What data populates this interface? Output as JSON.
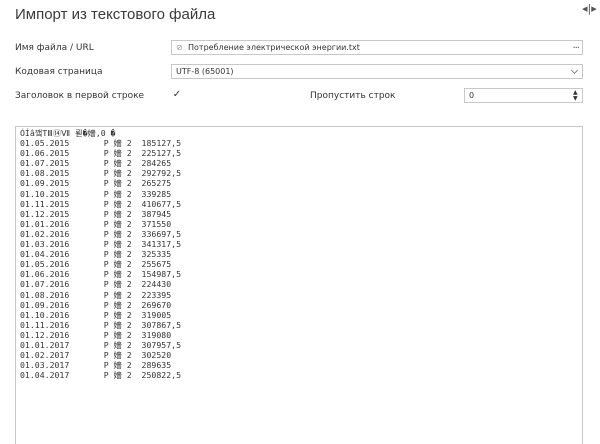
{
  "dialog": {
    "title": "Импорт из текстового файла"
  },
  "form": {
    "file_label": "Имя файла / URL",
    "file_value": "Потребление электрической энергии.txt",
    "browse_label": "...",
    "encoding_label": "Кодовая страница",
    "encoding_value": "UTF-8 (65001)",
    "header_label": "Заголовок в первой строке",
    "header_checked_glyph": "✓",
    "skip_label": "Пропустить строк",
    "skip_value": "0"
  },
  "icons": {
    "corner": "◂|▸",
    "file": "⊘",
    "spin_up": "▲",
    "spin_down": "▼"
  },
  "preview": {
    "lines": [
      "ÓÍâ꺀TⅢ⑭Ⅶ 뢷�嬙,0 �",
      "01.05.2015       Р 嬙 2  185127,5",
      "01.06.2015       Р 嬙 2  225127,5",
      "01.07.2015       Р 嬙 2  284265",
      "01.08.2015       Р 嬙 2  292792,5",
      "01.09.2015       Р 嬙 2  265275",
      "01.10.2015       Р 嬙 2  339285",
      "01.11.2015       Р 嬙 2  410677,5",
      "01.12.2015       Р 嬙 2  387945",
      "01.01.2016       Р 嬙 2  371550",
      "01.02.2016       Р 嬙 2  336697,5",
      "01.03.2016       Р 嬙 2  341317,5",
      "01.04.2016       Р 嬙 2  325335",
      "01.05.2016       Р 嬙 2  255675",
      "01.06.2016       Р 嬙 2  154987,5",
      "01.07.2016       Р 嬙 2  224430",
      "01.08.2016       Р 嬙 2  223395",
      "01.09.2016       Р 嬙 2  269670",
      "01.10.2016       Р 嬙 2  319005",
      "01.11.2016       Р 嬙 2  307867,5",
      "01.12.2016       Р 嬙 2  319080",
      "01.01.2017       Р 嬙 2  307957,5",
      "01.02.2017       Р 嬙 2  302520",
      "01.03.2017       Р 嬙 2  289635",
      "01.04.2017       Р 嬙 2  250822,5"
    ]
  }
}
